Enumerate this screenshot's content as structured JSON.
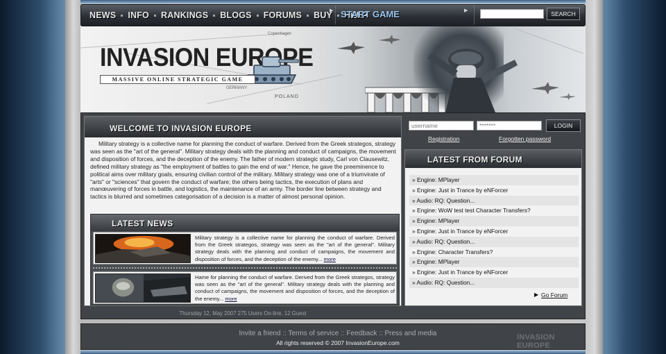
{
  "nav": {
    "items": [
      {
        "label": "NEWS"
      },
      {
        "label": "INFO"
      },
      {
        "label": "RANKINGS"
      },
      {
        "label": "BLOGS"
      },
      {
        "label": "FORUMS"
      },
      {
        "label": "BUY"
      },
      {
        "label": "HELP"
      }
    ],
    "start_game": "START GAME"
  },
  "search": {
    "placeholder": "",
    "button": "SEARCH"
  },
  "banner": {
    "title": "INVASION EUROPE",
    "subtitle": "MASSIVE ONLINE STRATEGIC GAME",
    "map_labels": {
      "poland": "POLAND",
      "germany": "GERMANY",
      "copenhagen": "Copenhagen"
    }
  },
  "welcome": {
    "title": "WELCOME to INVASION EUROPE",
    "text": "Military strategy is a collective name for planning the conduct of warfare. Derived from the Greek strategos, strategy was seen as the \"art of the general\". Military strategy deals with the planning and conduct of campaigns, the movement and disposition of forces, and the deception of the enemy. The father of modern strategic study, Carl von Clausewitz, defined military strategy as \"the employment of battles to gain the end of war.\" Hence, he gave the preeminence to political aims over military goals, ensuring civilian control of the military. Military strategy was one of a triumvirate of \"arts\" or \"sciences\" that govern the conduct of warfare; the others being tactics, the execution of plans and manœuvering of forces in battle, and logistics, the maintenance of an army. The border line between strategy and tactics is blurred and sometimes categorisation of a decision is a matter of almost personal opinion."
  },
  "news": {
    "title": "LATEST NEWS",
    "items": [
      {
        "text": "Military strategy is a collective name for planning the conduct of warfare. Derived from the Greek strategos, strategy was seen as the \"art of the general\". Military strategy deals with the planning and conduct of campaigns, the movement and disposition of forces, and the deception of the enemy...",
        "more": "more"
      },
      {
        "text": "Hame for planning the conduct of warfare. Derived from the Greek strategos, strategy was seen as the \"art of the general\". Military strategy deals with the planning and conduct of campaigns, the movement and disposition of forces, and the deception of the enemy...",
        "more": "more"
      }
    ]
  },
  "status": "Thursday 12, May 2007  275 Users On-line, 12 Guest",
  "login": {
    "username_placeholder": "username",
    "password_placeholder": "*******",
    "button": "LOGIN",
    "registration": "Registration",
    "forgotten": "Forgotten password"
  },
  "forum": {
    "title": "LATEST FROM FORUM",
    "items": [
      "» Engine: MPlayer",
      "» Engine: Just in Trance by eNForcer",
      "» Audio: RQ: Question...",
      "» Engine: WoW test test Character Transfers?",
      "» Engine: MPlayer",
      "» Engine: Just in Trance by eNForcer",
      "» Audio: RQ: Question...",
      "» Engine: Character Transfers?",
      "» Engine: MPlayer",
      "» Engine: Just in Trance by eNForcer",
      "» Audio: RQ: Question..."
    ],
    "go_forum": "Go Forum"
  },
  "footer": {
    "links": [
      "Invite a friend",
      "Terms of service",
      "Feedback",
      "Press and media"
    ],
    "separator": "::",
    "copyright": "All rights reserved © 2007 InvasionEurope.com",
    "logo": "INVASION EUROPE"
  }
}
